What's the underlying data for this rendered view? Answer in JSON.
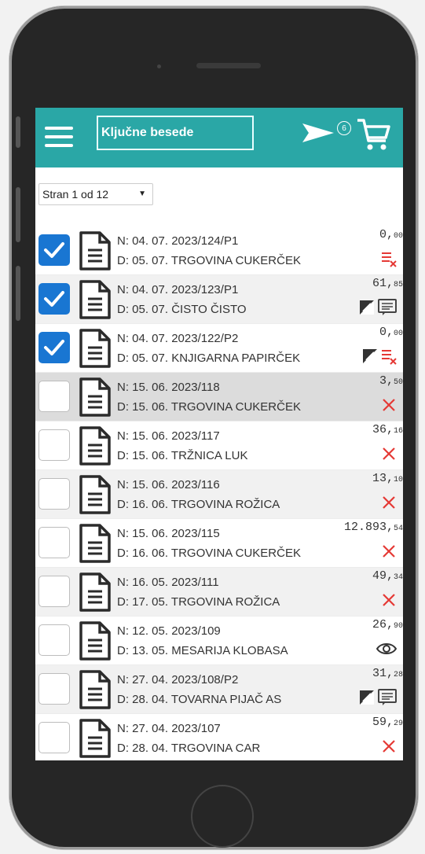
{
  "header": {
    "search_placeholder": "Ključne besede",
    "send_badge": "6"
  },
  "pager": {
    "label": "Stran 1 od 12",
    "chevron": "v"
  },
  "icons": {
    "menu": "hamburger-menu-icon",
    "send": "send-icon",
    "cart": "shopping-cart-icon",
    "document": "document-icon"
  },
  "colors": {
    "accent": "#2aa7a6",
    "checked": "#1976d2",
    "cancel": "#e53935",
    "row_shade": "#f1f1f1"
  },
  "rows": [
    {
      "checked": true,
      "line1": "N: 04. 07. 2023/124/P1",
      "line2": "D: 05. 07. TRGOVINA CUKERČEK",
      "amount_main": "0,",
      "amount_cents": "00",
      "status": [
        "list-cancel-icon"
      ]
    },
    {
      "checked": true,
      "line1": "N: 04. 07. 2023/123/P1",
      "line2": "D: 05. 07. ČISTO ČISTO",
      "amount_main": "61,",
      "amount_cents": "85",
      "status": [
        "edit-icon",
        "comment-icon"
      ]
    },
    {
      "checked": true,
      "line1": "N: 04. 07. 2023/122/P2",
      "line2": "D: 05. 07. KNJIGARNA PAPIRČEK",
      "amount_main": "0,",
      "amount_cents": "00",
      "status": [
        "edit-icon",
        "list-cancel-icon"
      ]
    },
    {
      "checked": false,
      "line1": "N: 15. 06. 2023/118",
      "line2": "D: 15. 06. TRGOVINA CUKERČEK",
      "amount_main": "3,",
      "amount_cents": "50",
      "status": [
        "cancel-x-icon"
      ],
      "active": true
    },
    {
      "checked": false,
      "line1": "N: 15. 06. 2023/117",
      "line2": "D: 15. 06. TRŽNICA LUK",
      "amount_main": "36,",
      "amount_cents": "16",
      "status": [
        "cancel-x-icon"
      ]
    },
    {
      "checked": false,
      "line1": "N: 15. 06. 2023/116",
      "line2": "D: 16. 06. TRGOVINA ROŽICA",
      "amount_main": "13,",
      "amount_cents": "10",
      "status": [
        "cancel-x-icon"
      ]
    },
    {
      "checked": false,
      "line1": "N: 15. 06. 2023/115",
      "line2": "D: 16. 06. TRGOVINA CUKERČEK",
      "amount_main": "12.893,",
      "amount_cents": "54",
      "status": [
        "cancel-x-icon"
      ]
    },
    {
      "checked": false,
      "line1": "N: 16. 05. 2023/111",
      "line2": "D: 17. 05. TRGOVINA ROŽICA",
      "amount_main": "49,",
      "amount_cents": "34",
      "status": [
        "cancel-x-icon"
      ]
    },
    {
      "checked": false,
      "line1": "N: 12. 05. 2023/109",
      "line2": "D: 13. 05. MESARIJA KLOBASA",
      "amount_main": "26,",
      "amount_cents": "90",
      "status": [
        "eye-icon"
      ]
    },
    {
      "checked": false,
      "line1": "N: 27. 04. 2023/108/P2",
      "line2": "D: 28. 04. TOVARNA PIJAČ AS",
      "amount_main": "31,",
      "amount_cents": "28",
      "status": [
        "edit-icon",
        "comment-icon"
      ]
    },
    {
      "checked": false,
      "line1": "N: 27. 04. 2023/107",
      "line2": "D: 28. 04. TRGOVINA CAR",
      "amount_main": "59,",
      "amount_cents": "29",
      "status": [
        "cancel-x-icon"
      ]
    }
  ]
}
